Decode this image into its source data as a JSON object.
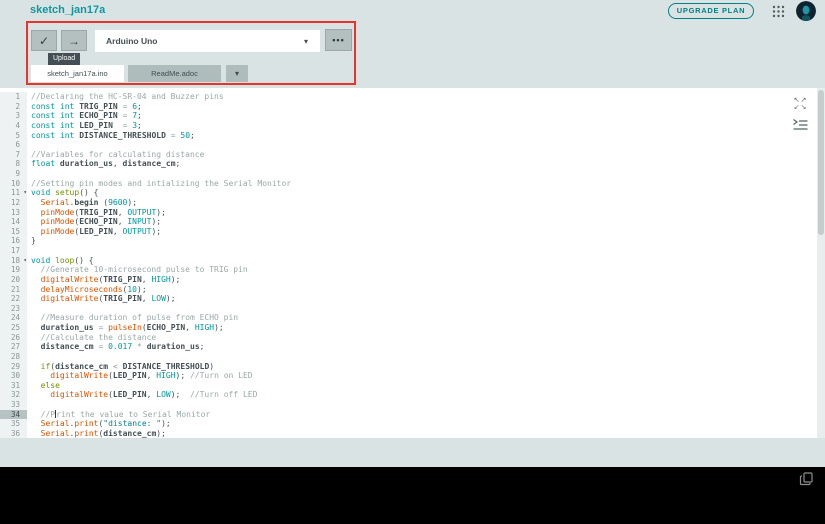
{
  "header": {
    "title": "sketch_jan17a",
    "upgrade_label": "UPGRADE PLAN"
  },
  "toolbar": {
    "board": "Arduino Uno",
    "tooltip": "Upload",
    "more_label": "•••",
    "verify_glyph": "✓",
    "upload_glyph": "→",
    "caret_glyph": "▾"
  },
  "tabs": {
    "main": "sketch_jan17a.ino",
    "readme": "ReadMe.adoc",
    "caret_glyph": "▾"
  },
  "colors": {
    "accent_teal": "#00979c",
    "highlight_red": "#e8342c",
    "keyword": "#00979c",
    "function": "#d35400",
    "control": "#728e00",
    "comment": "#9aa8a8",
    "console_bg": "#000000"
  },
  "editor": {
    "current_line": 34,
    "fold_lines": [
      11,
      18
    ],
    "fold_glyph": "▾",
    "lines": [
      [
        [
          "cm",
          "//Declaring the HC-SR-04 and Buzzer pins"
        ]
      ],
      [
        [
          "kw",
          "const"
        ],
        [
          "pl",
          " "
        ],
        [
          "kw",
          "int"
        ],
        [
          "pl",
          " "
        ],
        [
          "id",
          "TRIG_PIN"
        ],
        [
          "pl",
          " "
        ],
        [
          "op",
          "="
        ],
        [
          "pl",
          " "
        ],
        [
          "nu",
          "6"
        ],
        [
          "pl",
          ";"
        ]
      ],
      [
        [
          "kw",
          "const"
        ],
        [
          "pl",
          " "
        ],
        [
          "kw",
          "int"
        ],
        [
          "pl",
          " "
        ],
        [
          "id",
          "ECHO_PIN"
        ],
        [
          "pl",
          " "
        ],
        [
          "op",
          "="
        ],
        [
          "pl",
          " "
        ],
        [
          "nu",
          "7"
        ],
        [
          "pl",
          ";"
        ]
      ],
      [
        [
          "kw",
          "const"
        ],
        [
          "pl",
          " "
        ],
        [
          "kw",
          "int"
        ],
        [
          "pl",
          " "
        ],
        [
          "id",
          "LED_PIN"
        ],
        [
          "pl",
          "  "
        ],
        [
          "op",
          "="
        ],
        [
          "pl",
          " "
        ],
        [
          "nu",
          "3"
        ],
        [
          "pl",
          ";"
        ]
      ],
      [
        [
          "kw",
          "const"
        ],
        [
          "pl",
          " "
        ],
        [
          "kw",
          "int"
        ],
        [
          "pl",
          " "
        ],
        [
          "id",
          "DISTANCE_THRESHOLD"
        ],
        [
          "pl",
          " "
        ],
        [
          "op",
          "="
        ],
        [
          "pl",
          " "
        ],
        [
          "nu",
          "50"
        ],
        [
          "pl",
          ";"
        ]
      ],
      [],
      [
        [
          "cm",
          "//Variables for calculating distance"
        ]
      ],
      [
        [
          "kw",
          "float"
        ],
        [
          "pl",
          " "
        ],
        [
          "id",
          "duration_us"
        ],
        [
          "pl",
          ", "
        ],
        [
          "id",
          "distance_cm"
        ],
        [
          "pl",
          ";"
        ]
      ],
      [],
      [
        [
          "cm",
          "//Setting pin modes and intializing the Serial Monitor"
        ]
      ],
      [
        [
          "kw",
          "void"
        ],
        [
          "pl",
          " "
        ],
        [
          "ol",
          "setup"
        ],
        [
          "pl",
          "() {"
        ]
      ],
      [
        [
          "pl",
          "  "
        ],
        [
          "fn",
          "Serial"
        ],
        [
          "pl",
          "."
        ],
        [
          "id",
          "begin"
        ],
        [
          "pl",
          " ("
        ],
        [
          "nu",
          "9600"
        ],
        [
          "pl",
          ");"
        ]
      ],
      [
        [
          "pl",
          "  "
        ],
        [
          "fn",
          "pinMode"
        ],
        [
          "pl",
          "("
        ],
        [
          "id",
          "TRIG_PIN"
        ],
        [
          "pl",
          ", "
        ],
        [
          "kc",
          "OUTPUT"
        ],
        [
          "pl",
          ");"
        ]
      ],
      [
        [
          "pl",
          "  "
        ],
        [
          "fn",
          "pinMode"
        ],
        [
          "pl",
          "("
        ],
        [
          "id",
          "ECHO_PIN"
        ],
        [
          "pl",
          ", "
        ],
        [
          "kc",
          "INPUT"
        ],
        [
          "pl",
          ");"
        ]
      ],
      [
        [
          "pl",
          "  "
        ],
        [
          "fn",
          "pinMode"
        ],
        [
          "pl",
          "("
        ],
        [
          "id",
          "LED_PIN"
        ],
        [
          "pl",
          ", "
        ],
        [
          "kc",
          "OUTPUT"
        ],
        [
          "pl",
          ");"
        ]
      ],
      [
        [
          "pl",
          "}"
        ]
      ],
      [],
      [
        [
          "kw",
          "void"
        ],
        [
          "pl",
          " "
        ],
        [
          "ol",
          "loop"
        ],
        [
          "pl",
          "() {"
        ]
      ],
      [
        [
          "pl",
          "  "
        ],
        [
          "cm",
          "//Generate 10-microsecond pulse to TRIG pin"
        ]
      ],
      [
        [
          "pl",
          "  "
        ],
        [
          "fn",
          "digitalWrite"
        ],
        [
          "pl",
          "("
        ],
        [
          "id",
          "TRIG_PIN"
        ],
        [
          "pl",
          ", "
        ],
        [
          "kc",
          "HIGH"
        ],
        [
          "pl",
          ");"
        ]
      ],
      [
        [
          "pl",
          "  "
        ],
        [
          "fn",
          "delayMicroseconds"
        ],
        [
          "pl",
          "("
        ],
        [
          "nu",
          "10"
        ],
        [
          "pl",
          ");"
        ]
      ],
      [
        [
          "pl",
          "  "
        ],
        [
          "fn",
          "digitalWrite"
        ],
        [
          "pl",
          "("
        ],
        [
          "id",
          "TRIG_PIN"
        ],
        [
          "pl",
          ", "
        ],
        [
          "kc",
          "LOW"
        ],
        [
          "pl",
          ");"
        ]
      ],
      [],
      [
        [
          "pl",
          "  "
        ],
        [
          "cm",
          "//Measure duration of pulse from ECHO pin"
        ]
      ],
      [
        [
          "pl",
          "  "
        ],
        [
          "id",
          "duration_us"
        ],
        [
          "pl",
          " "
        ],
        [
          "op",
          "="
        ],
        [
          "pl",
          " "
        ],
        [
          "fn",
          "pulseIn"
        ],
        [
          "pl",
          "("
        ],
        [
          "id",
          "ECHO_PIN"
        ],
        [
          "pl",
          ", "
        ],
        [
          "kc",
          "HIGH"
        ],
        [
          "pl",
          ");"
        ]
      ],
      [
        [
          "pl",
          "  "
        ],
        [
          "cm",
          "//Calculate the distance"
        ]
      ],
      [
        [
          "pl",
          "  "
        ],
        [
          "id",
          "distance_cm"
        ],
        [
          "pl",
          " "
        ],
        [
          "op",
          "="
        ],
        [
          "pl",
          " "
        ],
        [
          "nu",
          "0.017"
        ],
        [
          "pl",
          " "
        ],
        [
          "op",
          "*"
        ],
        [
          "pl",
          " "
        ],
        [
          "id",
          "duration_us"
        ],
        [
          "pl",
          ";"
        ]
      ],
      [],
      [
        [
          "pl",
          "  "
        ],
        [
          "ol",
          "if"
        ],
        [
          "pl",
          "("
        ],
        [
          "id",
          "distance_cm"
        ],
        [
          "pl",
          " "
        ],
        [
          "op",
          "<"
        ],
        [
          "pl",
          " "
        ],
        [
          "id",
          "DISTANCE_THRESHOLD"
        ],
        [
          "pl",
          ")"
        ]
      ],
      [
        [
          "pl",
          "    "
        ],
        [
          "fn",
          "digitalWrite"
        ],
        [
          "pl",
          "("
        ],
        [
          "id",
          "LED_PIN"
        ],
        [
          "pl",
          ", "
        ],
        [
          "kc",
          "HIGH"
        ],
        [
          "pl",
          ");"
        ],
        [
          "pl",
          " "
        ],
        [
          "cm",
          "//Turn on LED"
        ]
      ],
      [
        [
          "pl",
          "  "
        ],
        [
          "ol",
          "else"
        ]
      ],
      [
        [
          "pl",
          "    "
        ],
        [
          "fn",
          "digitalWrite"
        ],
        [
          "pl",
          "("
        ],
        [
          "id",
          "LED_PIN"
        ],
        [
          "pl",
          ", "
        ],
        [
          "kc",
          "LOW"
        ],
        [
          "pl",
          ");"
        ],
        [
          "pl",
          "  "
        ],
        [
          "cm",
          "//Turn off LED"
        ]
      ],
      [],
      [
        [
          "pl",
          "  "
        ],
        [
          "cm",
          "//P"
        ],
        [
          "cur",
          ""
        ],
        [
          "cm",
          "rint the value to Serial Monitor"
        ]
      ],
      [
        [
          "pl",
          "  "
        ],
        [
          "fn",
          "Serial"
        ],
        [
          "pl",
          "."
        ],
        [
          "fn",
          "print"
        ],
        [
          "pl",
          "("
        ],
        [
          "st",
          "\"distance: \""
        ],
        [
          "pl",
          ");"
        ]
      ],
      [
        [
          "pl",
          "  "
        ],
        [
          "fn",
          "Serial"
        ],
        [
          "pl",
          "."
        ],
        [
          "fn",
          "print"
        ],
        [
          "pl",
          "("
        ],
        [
          "id",
          "distance_cm"
        ],
        [
          "pl",
          ");"
        ]
      ]
    ]
  }
}
